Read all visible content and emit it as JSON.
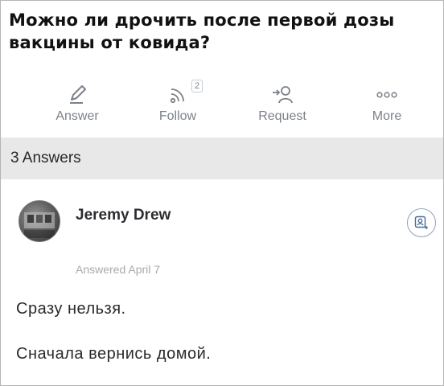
{
  "question": {
    "title": "Можно ли дрочить после первой дозы вакцины от ковида?"
  },
  "actions": [
    {
      "label": "Answer",
      "icon": "pencil-icon"
    },
    {
      "label": "Follow",
      "icon": "rss-follow-icon",
      "badge": "2"
    },
    {
      "label": "Request",
      "icon": "request-user-icon"
    },
    {
      "label": "More",
      "icon": "more-dots-icon"
    }
  ],
  "answers_header": "3 Answers",
  "answer": {
    "author": "Jeremy Drew",
    "date": "Answered April 7",
    "text": [
      "Сразу нельзя.",
      "Сначала вернись домой."
    ]
  }
}
